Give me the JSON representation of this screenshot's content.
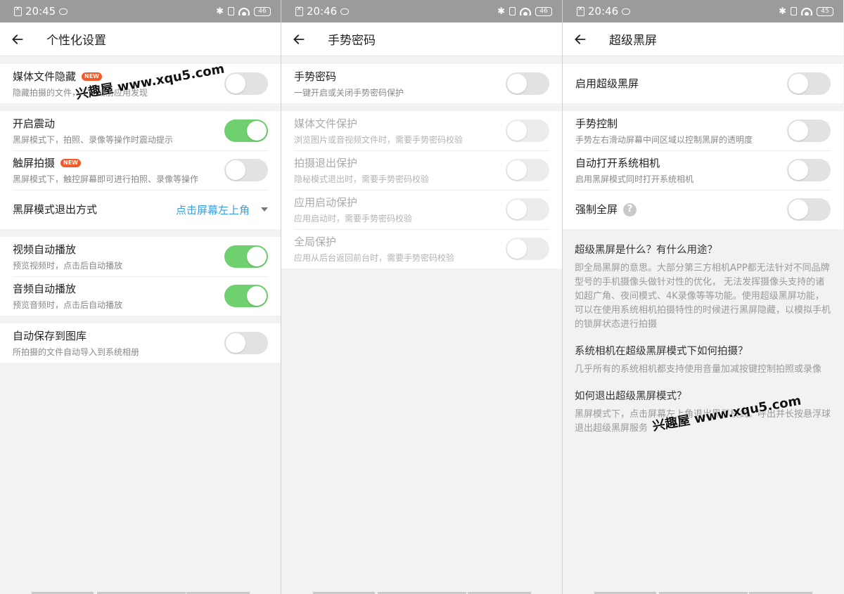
{
  "panels": [
    {
      "status": {
        "time": "20:45",
        "battery": "46"
      },
      "title": "个性化设置",
      "sections": [
        [
          {
            "title": "媒体文件隐藏",
            "badge": "NEW",
            "sub": "隐藏拍摄的文件，不被相册应用发现",
            "state": "off"
          }
        ],
        [
          {
            "title": "开启震动",
            "sub": "黑屏模式下，拍照、录像等操作时震动提示",
            "state": "on"
          },
          {
            "title": "触屏拍摄",
            "badge": "NEW",
            "sub": "黑屏模式下，触控屏幕即可进行拍照、录像等操作",
            "state": "off"
          },
          {
            "title": "黑屏模式退出方式",
            "select": "点击屏幕左上角"
          }
        ],
        [
          {
            "title": "视频自动播放",
            "sub": "预览视频时，点击后自动播放",
            "state": "on"
          },
          {
            "title": "音频自动播放",
            "sub": "预览音频时，点击后自动播放",
            "state": "on"
          }
        ],
        [
          {
            "title": "自动保存到图库",
            "sub": "所拍摄的文件自动导入到系统相册",
            "state": "off"
          }
        ]
      ]
    },
    {
      "status": {
        "time": "20:46",
        "battery": "46"
      },
      "title": "手势密码",
      "sections": [
        [
          {
            "title": "手势密码",
            "sub": "一键开启或关闭手势密码保护",
            "state": "off"
          }
        ],
        [
          {
            "title": "媒体文件保护",
            "sub": "浏览图片或音视频文件时，需要手势密码校验",
            "state": "disabled"
          },
          {
            "title": "拍摄退出保护",
            "sub": "隐秘模式退出时，需要手势密码校验",
            "state": "disabled"
          },
          {
            "title": "应用启动保护",
            "sub": "应用启动时，需要手势密码校验",
            "state": "disabled"
          },
          {
            "title": "全局保护",
            "sub": "应用从后台返回前台时，需要手势密码校验",
            "state": "disabled"
          }
        ]
      ]
    },
    {
      "status": {
        "time": "20:46",
        "battery": "45"
      },
      "title": "超级黑屏",
      "sections": [
        [
          {
            "title": "启用超级黑屏",
            "state": "off"
          }
        ],
        [
          {
            "title": "手势控制",
            "sub": "手势左右滑动屏幕中间区域以控制黑屏的透明度",
            "state": "off"
          },
          {
            "title": "自动打开系统相机",
            "sub": "启用黑屏模式同时打开系统相机",
            "state": "off"
          },
          {
            "title": "强制全屏",
            "help": "?",
            "state": "off"
          }
        ]
      ],
      "faq": [
        {
          "q": "超级黑屏是什么？有什么用途？",
          "a": "即全局黑屏的意思。大部分第三方相机APP都无法针对不同品牌型号的手机摄像头做针对性的优化， 无法发挥摄像头支持的诸如超广角、夜间模式、4K录像等等功能。使用超级黑屏功能， 可以在使用系统相机拍摄特性的时候进行黑屏隐藏，以模拟手机的锁屏状态进行拍摄"
        },
        {
          "q": "系统相机在超级黑屏模式下如何拍摄？",
          "a": "几乎所有的系统相机都支持使用音量加减按键控制拍照或录像"
        },
        {
          "q": "如何退出超级黑屏模式？",
          "a": "黑屏模式下，点击屏幕左上角退出黑屏模式。呼出并长按悬浮球退出超级黑屏服务"
        }
      ]
    }
  ],
  "watermark": "兴趣屋 www.xqu5.com",
  "colors": {
    "toggle_on": "#6ed06e",
    "link": "#3a9fe0",
    "badge": "#ef5b2a"
  }
}
